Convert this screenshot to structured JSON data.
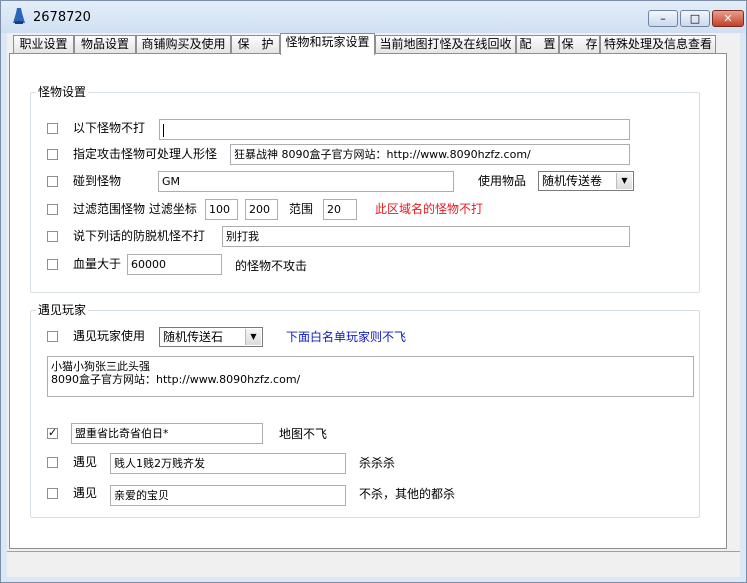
{
  "window": {
    "title": "2678720",
    "min_glyph": "–",
    "max_glyph": "□",
    "close_glyph": "✕"
  },
  "tabs": [
    {
      "label": "职业设置"
    },
    {
      "label": "物品设置"
    },
    {
      "label": "商铺购买及使用"
    },
    {
      "label": "保　护"
    },
    {
      "label": "怪物和玩家设置"
    },
    {
      "label": "当前地图打怪及在线回收"
    },
    {
      "label": "配　置"
    },
    {
      "label": "保　存"
    },
    {
      "label": "特殊处理及信息查看"
    }
  ],
  "monster": {
    "group_title": "怪物设置",
    "no_attack_label": "以下怪物不打",
    "no_attack_value": "",
    "attack_player_label": "指定攻击怪物可处理人形怪",
    "attack_player_value": "狂暴战神 8090盒子官方网站：http://www.8090hzfz.com/",
    "meet_label": "碰到怪物",
    "meet_value": "GM",
    "use_item_label": "使用物品",
    "use_item_value": "随机传送卷",
    "filter_label": "过滤范围怪物 过滤坐标",
    "filter_x": "100",
    "filter_y": "200",
    "range_label": "范围",
    "range_value": "20",
    "filter_note": "此区域名的怪物不打",
    "antibot_label": "说下列话的防脱机怪不打",
    "antibot_value": "别打我",
    "hp_label": "血量大于",
    "hp_value": "60000",
    "hp_suffix": "的怪物不攻击"
  },
  "player": {
    "group_title": "遇见玩家",
    "meet_use_label": "遇见玩家使用",
    "meet_use_value": "随机传送石",
    "whitelist_note": "下面白名单玩家则不飞",
    "whitelist_lines": [
      "小猫小狗张三此头强",
      "8090盒子官方网站：http://www.8090hzfz.com/"
    ],
    "alliance_value": "盟重省比奇省伯日*",
    "alliance_note": "地图不飞",
    "meet1_label": "遇见",
    "meet1_value": "贱人1贱2万贱齐发",
    "meet1_note": "杀杀杀",
    "meet2_label": "遇见",
    "meet2_value": "亲爱的宝贝",
    "meet2_note": "不杀，其他的都杀"
  },
  "colors": {
    "warning_text": "#e8191f",
    "info_text": "#0b1cc4"
  }
}
